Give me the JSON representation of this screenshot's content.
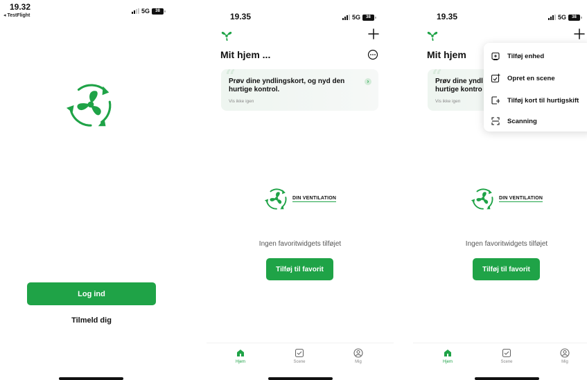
{
  "screen1": {
    "time": "19.32",
    "back_app": "◂ TestFlight",
    "network": "5G",
    "battery": "38",
    "login_label": "Log ind",
    "signup_label": "Tilmeld dig"
  },
  "screen2": {
    "time": "19.35",
    "network": "5G",
    "battery": "38",
    "home_title": "Mit hjem ...",
    "tip": {
      "text_line1": "Prøv dine yndlingskort, og nyd den",
      "text_line2": "hurtige kontrol.",
      "dismiss": "Vis ikke igen"
    },
    "brand_name": "DIN VENTILATION",
    "empty_message": "Ingen favoritwidgets tilføjet",
    "add_favorite_label": "Tilføj til favorit",
    "tabs": [
      {
        "label": "Hjem",
        "icon": "home-icon",
        "active": true
      },
      {
        "label": "Scene",
        "icon": "scene-check-icon",
        "active": false
      },
      {
        "label": "Mig",
        "icon": "profile-icon",
        "active": false
      }
    ]
  },
  "screen3": {
    "time": "19.35",
    "network": "5G",
    "battery": "38",
    "home_title": "Mit hjem",
    "tip": {
      "text_line1": "Prøv dine yndl",
      "text_line2": "hurtige kontro",
      "dismiss": "Vis ikke igen"
    },
    "brand_name": "DIN VENTILATION",
    "empty_message": "Ingen favoritwidgets tilføjet",
    "add_favorite_label": "Tilføj til favorit",
    "menu": [
      {
        "label": "Tilføj enhed",
        "icon": "add-device-icon"
      },
      {
        "label": "Opret en scene",
        "icon": "create-scene-icon"
      },
      {
        "label": "Tilføj kort til hurtigskift",
        "icon": "add-card-icon"
      },
      {
        "label": "Scanning",
        "icon": "scan-icon"
      }
    ],
    "tabs": [
      {
        "label": "Hjem",
        "icon": "home-icon",
        "active": true
      },
      {
        "label": "Scene",
        "icon": "scene-check-icon",
        "active": false
      },
      {
        "label": "Mig",
        "icon": "profile-icon",
        "active": false
      }
    ]
  },
  "colors": {
    "brand_green": "#1fa347",
    "text_dark": "#111111",
    "text_muted": "#888888",
    "tip_background": "#eef5f0"
  }
}
